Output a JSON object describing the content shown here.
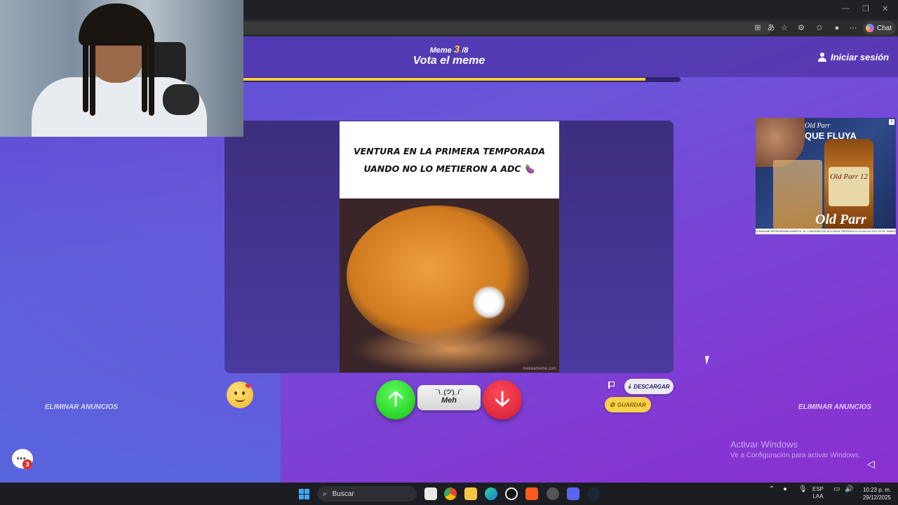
{
  "browser": {
    "chat_label": "Chat"
  },
  "header": {
    "meme_label": "Meme",
    "meme_current": "3",
    "meme_total": "/8",
    "title": "Vota el meme",
    "login_label": "Iniciar sesión",
    "progress_fraction": 0.92
  },
  "meme": {
    "caption": "VENTURA EN LA PRIMERA TEMPORADA UANDO NO LO METIERON A ADC 🍆",
    "watermark": "makeameme.com"
  },
  "ad": {
    "brand": "Old Parr",
    "headline": "QUE FLUYA",
    "bottle_label": "Old Parr 12",
    "disclaimer": "CONSUME RESPONSABLEMENTE. EL CONSUMO DE ALCOHOL PERJUDICA LA SALUD LEY 42 93. WWW.DRINKIQ.COM"
  },
  "actions": {
    "remove_ads_left": "ELIMINAR ANUNCIOS",
    "remove_ads_right": "ELIMINAR ANUNCIOS",
    "meh_face": "¯\\_(ツ)_/¯",
    "meh_label": "Meh",
    "download_label": "DESCARGAR",
    "save_label": "GUARDAR",
    "chat_badge": "3"
  },
  "windows": {
    "activate_title": "Activar Windows",
    "activate_sub": "Ve a Configuración para activar Windows."
  },
  "taskbar": {
    "search_label": "Buscar",
    "lang_top": "ESP",
    "lang_bottom": "LAA",
    "time": "10:23 p. m.",
    "date": "29/12/2025"
  },
  "colors": {
    "accent_yellow": "#ffd23a",
    "vote_up": "#18c018",
    "vote_down": "#d01a30"
  }
}
